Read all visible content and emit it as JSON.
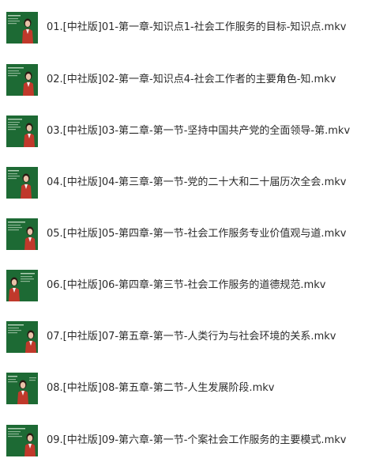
{
  "files": [
    {
      "name": "01.[中社版]01-第一章-知识点1-社会工作服务的目标-知识点.mkv",
      "thumbnail_icon": "video-thumbnail-icon"
    },
    {
      "name": "02.[中社版]02-第一章-知识点4-社会工作者的主要角色-知.mkv",
      "thumbnail_icon": "video-thumbnail-icon"
    },
    {
      "name": "03.[中社版]03-第二章-第一节-坚持中国共产党的全面领导-第.mkv",
      "thumbnail_icon": "video-thumbnail-icon"
    },
    {
      "name": "04.[中社版]04-第三章-第一节-党的二十大和二十届历次全会.mkv",
      "thumbnail_icon": "video-thumbnail-icon"
    },
    {
      "name": "05.[中社版]05-第四章-第一节-社会工作服务专业价值观与道.mkv",
      "thumbnail_icon": "video-thumbnail-icon"
    },
    {
      "name": "06.[中社版]06-第四章-第三节-社会工作服务的道德规范.mkv",
      "thumbnail_icon": "video-thumbnail-icon"
    },
    {
      "name": "07.[中社版]07-第五章-第一节-人类行为与社会环境的关系.mkv",
      "thumbnail_icon": "video-thumbnail-icon"
    },
    {
      "name": "08.[中社版]08-第五章-第二节-人生发展阶段.mkv",
      "thumbnail_icon": "video-thumbnail-icon"
    },
    {
      "name": "09.[中社版]09-第六章-第一节-个案社会工作服务的主要模式.mkv",
      "thumbnail_icon": "video-thumbnail-icon"
    }
  ],
  "colors": {
    "text": "#2b2b2b",
    "board_green": "#1e6b35",
    "presenter_red": "#c0392b"
  }
}
